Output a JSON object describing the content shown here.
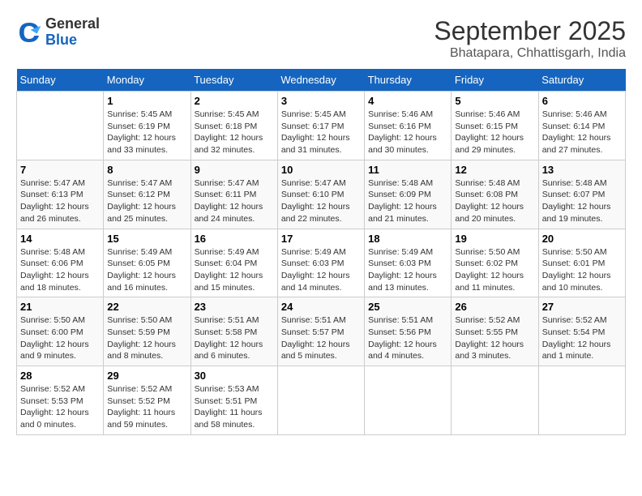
{
  "logo": {
    "line1": "General",
    "line2": "Blue"
  },
  "title": "September 2025",
  "location": "Bhatapara, Chhattisgarh, India",
  "days_header": [
    "Sunday",
    "Monday",
    "Tuesday",
    "Wednesday",
    "Thursday",
    "Friday",
    "Saturday"
  ],
  "weeks": [
    [
      {
        "day": null,
        "info": null
      },
      {
        "day": "1",
        "info": "Sunrise: 5:45 AM\nSunset: 6:19 PM\nDaylight: 12 hours\nand 33 minutes."
      },
      {
        "day": "2",
        "info": "Sunrise: 5:45 AM\nSunset: 6:18 PM\nDaylight: 12 hours\nand 32 minutes."
      },
      {
        "day": "3",
        "info": "Sunrise: 5:45 AM\nSunset: 6:17 PM\nDaylight: 12 hours\nand 31 minutes."
      },
      {
        "day": "4",
        "info": "Sunrise: 5:46 AM\nSunset: 6:16 PM\nDaylight: 12 hours\nand 30 minutes."
      },
      {
        "day": "5",
        "info": "Sunrise: 5:46 AM\nSunset: 6:15 PM\nDaylight: 12 hours\nand 29 minutes."
      },
      {
        "day": "6",
        "info": "Sunrise: 5:46 AM\nSunset: 6:14 PM\nDaylight: 12 hours\nand 27 minutes."
      }
    ],
    [
      {
        "day": "7",
        "info": "Sunrise: 5:47 AM\nSunset: 6:13 PM\nDaylight: 12 hours\nand 26 minutes."
      },
      {
        "day": "8",
        "info": "Sunrise: 5:47 AM\nSunset: 6:12 PM\nDaylight: 12 hours\nand 25 minutes."
      },
      {
        "day": "9",
        "info": "Sunrise: 5:47 AM\nSunset: 6:11 PM\nDaylight: 12 hours\nand 24 minutes."
      },
      {
        "day": "10",
        "info": "Sunrise: 5:47 AM\nSunset: 6:10 PM\nDaylight: 12 hours\nand 22 minutes."
      },
      {
        "day": "11",
        "info": "Sunrise: 5:48 AM\nSunset: 6:09 PM\nDaylight: 12 hours\nand 21 minutes."
      },
      {
        "day": "12",
        "info": "Sunrise: 5:48 AM\nSunset: 6:08 PM\nDaylight: 12 hours\nand 20 minutes."
      },
      {
        "day": "13",
        "info": "Sunrise: 5:48 AM\nSunset: 6:07 PM\nDaylight: 12 hours\nand 19 minutes."
      }
    ],
    [
      {
        "day": "14",
        "info": "Sunrise: 5:48 AM\nSunset: 6:06 PM\nDaylight: 12 hours\nand 18 minutes."
      },
      {
        "day": "15",
        "info": "Sunrise: 5:49 AM\nSunset: 6:05 PM\nDaylight: 12 hours\nand 16 minutes."
      },
      {
        "day": "16",
        "info": "Sunrise: 5:49 AM\nSunset: 6:04 PM\nDaylight: 12 hours\nand 15 minutes."
      },
      {
        "day": "17",
        "info": "Sunrise: 5:49 AM\nSunset: 6:03 PM\nDaylight: 12 hours\nand 14 minutes."
      },
      {
        "day": "18",
        "info": "Sunrise: 5:49 AM\nSunset: 6:03 PM\nDaylight: 12 hours\nand 13 minutes."
      },
      {
        "day": "19",
        "info": "Sunrise: 5:50 AM\nSunset: 6:02 PM\nDaylight: 12 hours\nand 11 minutes."
      },
      {
        "day": "20",
        "info": "Sunrise: 5:50 AM\nSunset: 6:01 PM\nDaylight: 12 hours\nand 10 minutes."
      }
    ],
    [
      {
        "day": "21",
        "info": "Sunrise: 5:50 AM\nSunset: 6:00 PM\nDaylight: 12 hours\nand 9 minutes."
      },
      {
        "day": "22",
        "info": "Sunrise: 5:50 AM\nSunset: 5:59 PM\nDaylight: 12 hours\nand 8 minutes."
      },
      {
        "day": "23",
        "info": "Sunrise: 5:51 AM\nSunset: 5:58 PM\nDaylight: 12 hours\nand 6 minutes."
      },
      {
        "day": "24",
        "info": "Sunrise: 5:51 AM\nSunset: 5:57 PM\nDaylight: 12 hours\nand 5 minutes."
      },
      {
        "day": "25",
        "info": "Sunrise: 5:51 AM\nSunset: 5:56 PM\nDaylight: 12 hours\nand 4 minutes."
      },
      {
        "day": "26",
        "info": "Sunrise: 5:52 AM\nSunset: 5:55 PM\nDaylight: 12 hours\nand 3 minutes."
      },
      {
        "day": "27",
        "info": "Sunrise: 5:52 AM\nSunset: 5:54 PM\nDaylight: 12 hours\nand 1 minute."
      }
    ],
    [
      {
        "day": "28",
        "info": "Sunrise: 5:52 AM\nSunset: 5:53 PM\nDaylight: 12 hours\nand 0 minutes."
      },
      {
        "day": "29",
        "info": "Sunrise: 5:52 AM\nSunset: 5:52 PM\nDaylight: 11 hours\nand 59 minutes."
      },
      {
        "day": "30",
        "info": "Sunrise: 5:53 AM\nSunset: 5:51 PM\nDaylight: 11 hours\nand 58 minutes."
      },
      {
        "day": null,
        "info": null
      },
      {
        "day": null,
        "info": null
      },
      {
        "day": null,
        "info": null
      },
      {
        "day": null,
        "info": null
      }
    ]
  ]
}
